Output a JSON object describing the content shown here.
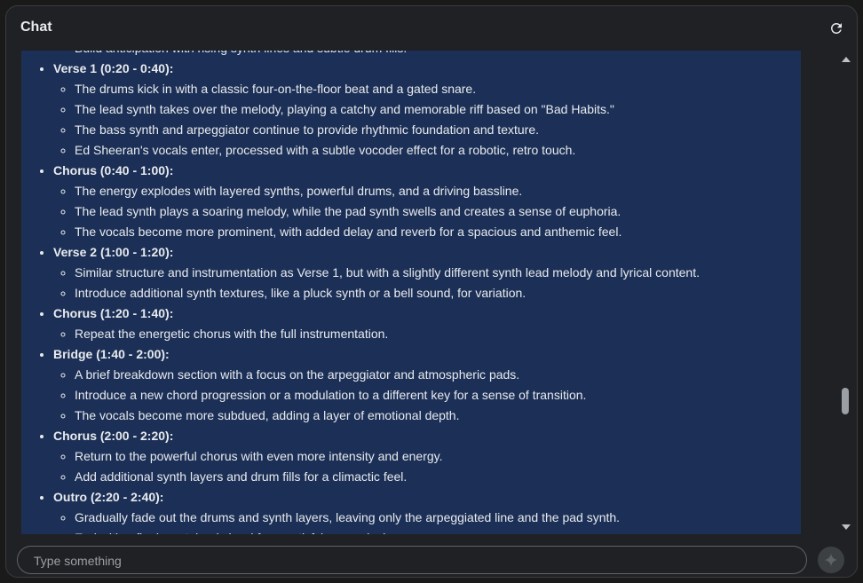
{
  "header": {
    "title": "Chat"
  },
  "icons": {
    "refresh": "refresh-icon",
    "send": "sparkle-icon"
  },
  "colors": {
    "content_bg": "#1c3057",
    "window_bg": "#202124"
  },
  "content": {
    "partial_top_line": "Build anticipation with rising synth lines and subtle drum fills.",
    "sections": [
      {
        "title": "Verse 1 (0:20 - 0:40):",
        "items": [
          "The drums kick in with a classic four-on-the-floor beat and a gated snare.",
          "The lead synth takes over the melody, playing a catchy and memorable riff based on \"Bad Habits.\"",
          "The bass synth and arpeggiator continue to provide rhythmic foundation and texture.",
          "Ed Sheeran's vocals enter, processed with a subtle vocoder effect for a robotic, retro touch."
        ]
      },
      {
        "title": "Chorus (0:40 - 1:00):",
        "items": [
          "The energy explodes with layered synths, powerful drums, and a driving bassline.",
          "The lead synth plays a soaring melody, while the pad synth swells and creates a sense of euphoria.",
          "The vocals become more prominent, with added delay and reverb for a spacious and anthemic feel."
        ]
      },
      {
        "title": "Verse 2 (1:00 - 1:20):",
        "items": [
          "Similar structure and instrumentation as Verse 1, but with a slightly different synth lead melody and lyrical content.",
          "Introduce additional synth textures, like a pluck synth or a bell sound, for variation."
        ]
      },
      {
        "title": "Chorus (1:20 - 1:40):",
        "items": [
          "Repeat the energetic chorus with the full instrumentation."
        ]
      },
      {
        "title": "Bridge (1:40 - 2:00):",
        "items": [
          "A brief breakdown section with a focus on the arpeggiator and atmospheric pads.",
          "Introduce a new chord progression or a modulation to a different key for a sense of transition.",
          "The vocals become more subdued, adding a layer of emotional depth."
        ]
      },
      {
        "title": "Chorus (2:00 - 2:20):",
        "items": [
          "Return to the powerful chorus with even more intensity and energy.",
          "Add additional synth layers and drum fills for a climactic feel."
        ]
      },
      {
        "title": "Outro (2:20 - 2:40):",
        "items": [
          "Gradually fade out the drums and synth layers, leaving only the arpeggiated line and the pad synth.",
          "End with a final, sustained chord for a satisfying conclusion."
        ]
      }
    ]
  },
  "input": {
    "placeholder": "Type something",
    "value": ""
  }
}
